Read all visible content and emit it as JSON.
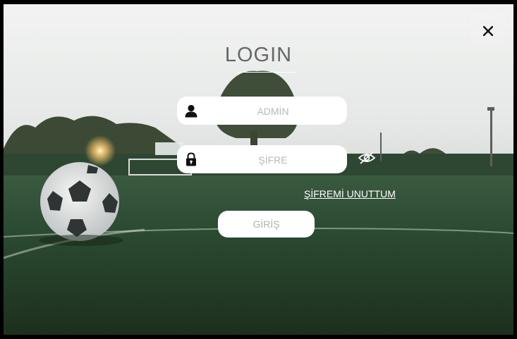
{
  "dialog": {
    "title": "LOGIN",
    "close_label": "✕"
  },
  "form": {
    "username": {
      "value": "",
      "placeholder": "ADMİN"
    },
    "password": {
      "value": "",
      "placeholder": "ŞİFRE"
    },
    "forgot_label": "ŞİFREMİ UNUTTUM",
    "login_label": "GİRİŞ"
  },
  "icons": {
    "user": "user-icon",
    "lock": "lock-icon",
    "eye": "eye-off-icon",
    "close": "close-icon"
  },
  "colors": {
    "title": "#666666",
    "field_bg": "#ffffff",
    "placeholder": "#b8b8b8",
    "link": "#ffffff"
  }
}
